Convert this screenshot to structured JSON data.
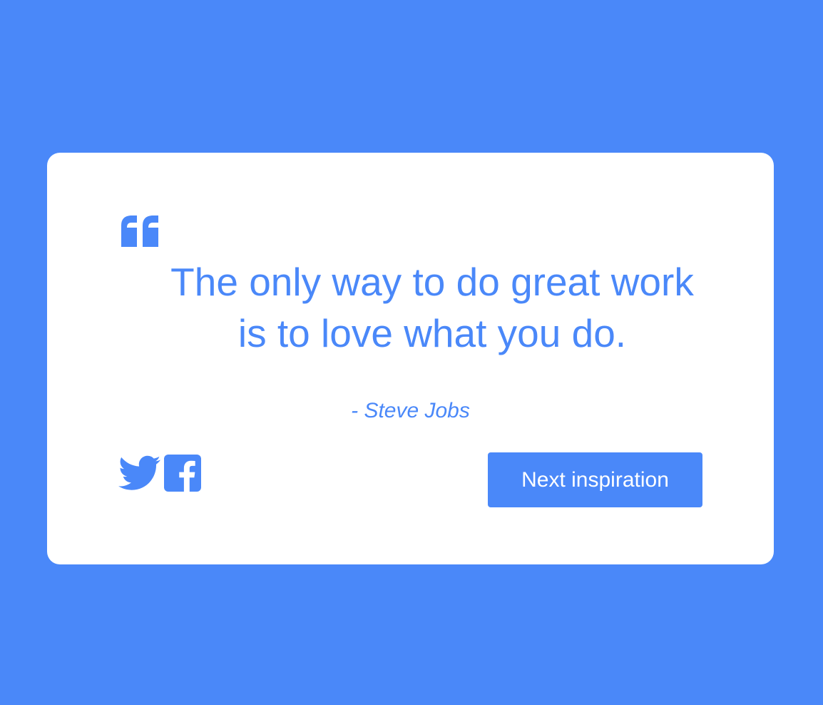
{
  "quote": {
    "text": "The only way to do great work is to love what you do.",
    "author": "- Steve Jobs"
  },
  "actions": {
    "next_label": "Next inspiration"
  },
  "icons": {
    "quote": "quote-icon",
    "twitter": "twitter-icon",
    "facebook": "facebook-icon"
  },
  "colors": {
    "background": "#4a88f9",
    "card": "#ffffff",
    "accent": "#4a88f9",
    "button_text": "#ffffff"
  }
}
